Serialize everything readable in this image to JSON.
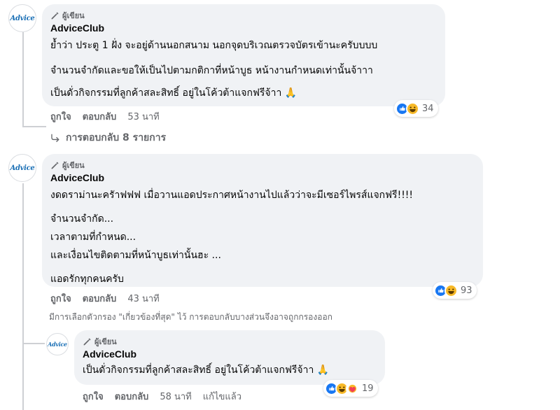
{
  "comments": [
    {
      "avatar_text": "Advice",
      "badge": "ผู้เขียน",
      "author": "AdviceClub",
      "lines": [
        "ย้ำว่า ประตู 1 ฝั่ง จะอยู่ด้านนอกสนาม นอกจุดบริเวณตรวจบัตรเข้านะครับบบบ",
        "จำนวนจำกัดและขอให้เป็นไปตามกติกาที่หน้าบูธ หน้างานกำหนดเท่านั้นจ้าาา",
        "เป็นดั่วกิจกรรมที่ลูกค้าสละสิทธิ์ อยู่ในโค้วต้าแจกฟรีจ้าา 🙏"
      ],
      "like": "ถูกใจ",
      "reply": "ตอบกลับ",
      "time": "53 นาที",
      "reaction_count": "34",
      "replies_link": "การตอบกลับ 8 รายการ"
    },
    {
      "avatar_text": "Advice",
      "badge": "ผู้เขียน",
      "author": "AdviceClub",
      "lines": [
        "งดดราม่านะครัาฟฟฟ เมื่อวานแอดประกาศหน้างานไปแล้วว่าจะมีเซอร์ไพรส์แจกฟรี!!!!",
        "จำนวนจำกัด...",
        "เวลาตามที่กำหนด...",
        "และเงื่อนไขติดตามที่หน้าบูธเท่านั้นฮะ ...",
        "แอดรักทุกคนครับ"
      ],
      "like": "ถูกใจ",
      "reply": "ตอบกลับ",
      "time": "43 นาที",
      "reaction_count": "93",
      "filter_note": "มีการเลือกตัวกรอง \"เกี่ยวข้องที่สุด\" ไว้ การตอบกลับบางส่วนจึงอาจถูกกรองออก"
    },
    {
      "avatar_text": "Advice",
      "badge": "ผู้เขียน",
      "author": "AdviceClub",
      "lines": [
        "เป็นดั่วกิจกรรมที่ลูกค้าสละสิทธิ์ อยู่ในโค้วต้าแจกฟรีจ้าา 🙏"
      ],
      "like": "ถูกใจ",
      "reply": "ตอบกลับ",
      "time": "58 นาที",
      "edited": "แก้ไขแล้ว",
      "reaction_count": "19"
    }
  ],
  "colors": {
    "bubble": "#f0f2f5",
    "like_blue": "#1877f2",
    "haha_yellow": "#f7b928",
    "care_red": "#f33e58",
    "meta_gray": "#65676b"
  }
}
